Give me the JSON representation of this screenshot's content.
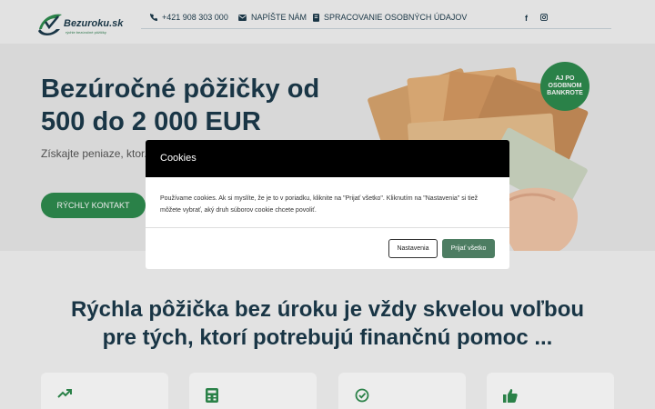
{
  "header": {
    "logo_text": "Bezuroku.sk",
    "logo_tagline": "rýchle bezúročné pôžičky",
    "phone": "+421 908 303 000",
    "write_us": "NAPÍŠTE NÁM",
    "privacy": "SPRACOVANIE OSOBNÝCH ÚDAJOV",
    "social_facebook": "f",
    "social_instagram_icon": "instagram-icon"
  },
  "hero": {
    "title": "Bezúročné pôžičky od 500 do 2 000 EUR",
    "subtitle": "Získajte peniaze, ktor... života, bez akýchkoľv...",
    "cta": "RÝCHLY KONTAKT",
    "badge": "AJ PO OSOBNOM BANKROTE"
  },
  "section": {
    "title": "Rýchla pôžička bez úroku je vždy skvelou voľbou pre tých, ktorí potrebujú finančnú pomoc ...",
    "card_icons": [
      "trending-up-icon",
      "calculator-icon",
      "check-circle-icon",
      "thumbs-up-icon"
    ]
  },
  "cookie_modal": {
    "title": "Cookies",
    "text": "Používame cookies. Ak si myslíte, že je to v poriadku, kliknite na \"Prijať všetko\". Kliknutím na \"Nastavenia\" si tiež môžete vybrať, aký druh súborov cookie chcete povoliť.",
    "settings_label": "Nastavenia",
    "accept_label": "Prijať všetko"
  },
  "colors": {
    "brand_dark": "#1b3a4b",
    "brand_green": "#2e8b4e",
    "accept_button": "#4d7d62"
  }
}
